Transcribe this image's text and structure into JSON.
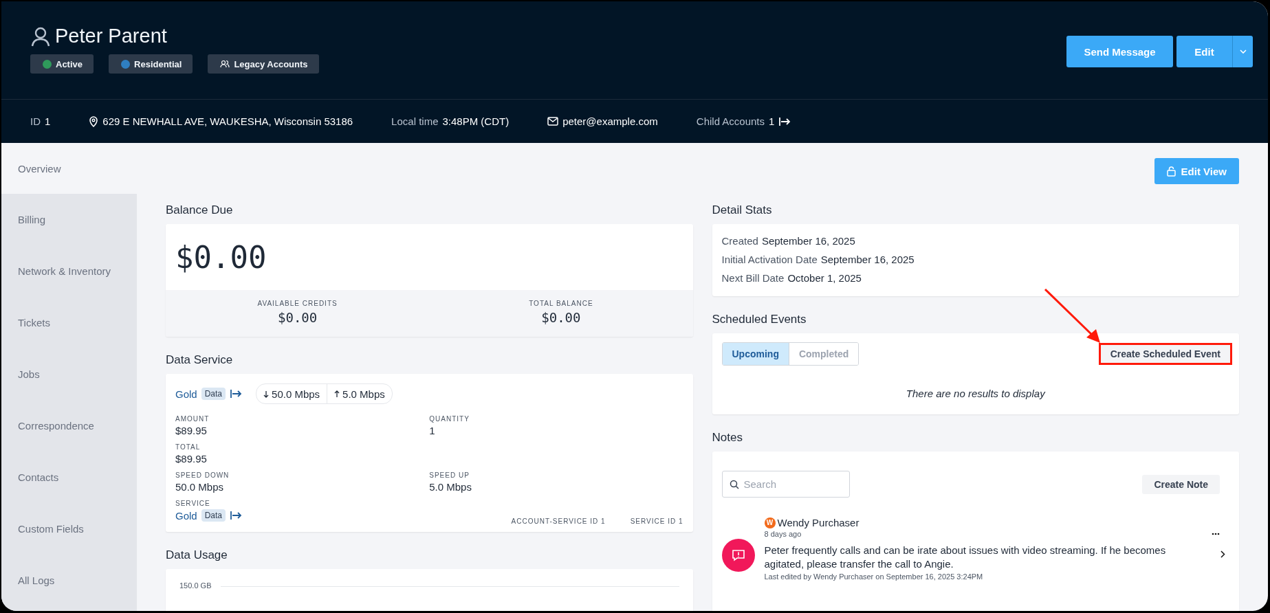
{
  "customer": {
    "name": "Peter Parent",
    "badges": [
      {
        "kind": "dot",
        "label": "Active",
        "color": "#2f9a5b"
      },
      {
        "kind": "dot",
        "label": "Residential",
        "color": "#2f7fc1"
      },
      {
        "kind": "icon",
        "label": "Legacy Accounts"
      }
    ]
  },
  "header_actions": {
    "send": "Send Message",
    "edit": "Edit"
  },
  "info_bar": [
    {
      "kind": "pair",
      "label": "ID",
      "value": "1"
    },
    {
      "kind": "address",
      "value": "629 E NEWHALL AVE, WAUKESHA, Wisconsin 53186"
    },
    {
      "kind": "pair",
      "label": "Local time",
      "value": "3:48PM (CDT)"
    },
    {
      "kind": "email",
      "value": "peter@example.com"
    },
    {
      "kind": "link",
      "label": "Child Accounts",
      "value": "1"
    }
  ],
  "sidebar": {
    "items": [
      {
        "label": "Overview",
        "selected": true
      },
      {
        "label": "Billing",
        "selected": false
      },
      {
        "label": "Network & Inventory",
        "selected": false
      },
      {
        "label": "Tickets",
        "selected": false
      },
      {
        "label": "Jobs",
        "selected": false
      },
      {
        "label": "Correspondence",
        "selected": false
      },
      {
        "label": "Contacts",
        "selected": false
      },
      {
        "label": "Custom Fields",
        "selected": false
      },
      {
        "label": "All Logs",
        "selected": false
      }
    ]
  },
  "edit_view": "Edit View",
  "balance": {
    "title": "Balance Due",
    "amount": "$0.00",
    "stats": [
      {
        "label": "AVAILABLE CREDITS",
        "value": "$0.00"
      },
      {
        "label": "TOTAL BALANCE",
        "value": "$0.00"
      }
    ]
  },
  "data_service": {
    "title": "Data Service",
    "plan": "Gold",
    "plan_tag": "Data",
    "speed_down": "50.0 Mbps",
    "speed_up": "5.0 Mbps",
    "rows": [
      [
        {
          "label": "AMOUNT",
          "value": "$89.95"
        },
        {
          "label": "QUANTITY",
          "value": "1"
        }
      ],
      [
        {
          "label": "TOTAL",
          "value": "$89.95"
        }
      ],
      [
        {
          "label": "SPEED DOWN",
          "value": "50.0 Mbps"
        },
        {
          "label": "SPEED UP",
          "value": "5.0 Mbps"
        }
      ]
    ],
    "service": {
      "label": "SERVICE",
      "plan": "Gold",
      "tag": "Data"
    },
    "ids": [
      "ACCOUNT-SERVICE ID 1",
      "SERVICE ID 1"
    ]
  },
  "data_usage": {
    "title": "Data Usage",
    "axis_label": "150.0 GB"
  },
  "detail_stats": {
    "title": "Detail Stats",
    "rows": [
      {
        "label": "Created",
        "value": "September 16, 2025"
      },
      {
        "label": "Initial Activation Date",
        "value": "September 16, 2025"
      },
      {
        "label": "Next Bill Date",
        "value": "October 1, 2025"
      }
    ]
  },
  "scheduled_events": {
    "title": "Scheduled Events",
    "tabs": [
      {
        "label": "Upcoming",
        "selected": true
      },
      {
        "label": "Completed",
        "selected": false
      }
    ],
    "create_button": {
      "label": "Create Scheduled Event",
      "highlighted": true
    },
    "empty_text": "There are no results to display"
  },
  "notes": {
    "title": "Notes",
    "search_placeholder": "Search",
    "create": "Create Note",
    "items": [
      {
        "author": "Wendy Purchaser",
        "author_initial": "W",
        "time": "8 days ago",
        "text": "Peter frequently calls and can be irate about issues with video streaming. If he becomes agitated, please transfer the call to Angie.",
        "edited": "Last edited by Wendy Purchaser on September 16, 2025 3:24PM"
      }
    ]
  }
}
